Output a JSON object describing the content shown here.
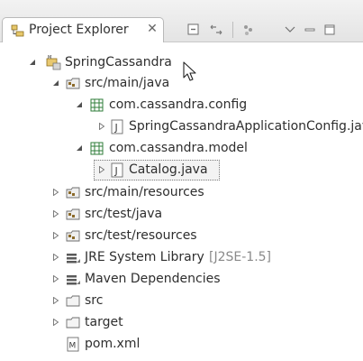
{
  "tab": {
    "label": "Project Explorer",
    "close": "✕"
  },
  "toolbar": {
    "icons": [
      "collapse-all-icon",
      "link-with-editor-icon",
      "focus-icon",
      "view-menu-icon",
      "minimize-icon",
      "maximize-icon"
    ]
  },
  "tree": {
    "items": [
      {
        "label": "SpringCassandra",
        "icon": "project-icon",
        "expanded": true
      },
      {
        "label": "src/main/java",
        "icon": "source-folder-icon",
        "expanded": true
      },
      {
        "label": "com.cassandra.config",
        "icon": "package-icon",
        "expanded": true
      },
      {
        "label": "SpringCassandraApplicationConfig.java",
        "icon": "java-file-icon",
        "expanded": false
      },
      {
        "label": "com.cassandra.model",
        "icon": "package-icon",
        "expanded": true
      },
      {
        "label": "Catalog.java",
        "icon": "java-file-icon",
        "expanded": false,
        "selected": true
      },
      {
        "label": "src/main/resources",
        "icon": "source-folder-icon",
        "expanded": false
      },
      {
        "label": "src/test/java",
        "icon": "source-folder-icon",
        "expanded": false
      },
      {
        "label": "src/test/resources",
        "icon": "source-folder-icon",
        "expanded": false
      },
      {
        "label": "JRE System Library",
        "decoration": "[J2SE-1.5]",
        "icon": "library-icon",
        "expanded": false
      },
      {
        "label": "Maven Dependencies",
        "icon": "library-icon",
        "expanded": false
      },
      {
        "label": "src",
        "icon": "folder-icon",
        "expanded": false
      },
      {
        "label": "target",
        "icon": "folder-icon",
        "expanded": false
      },
      {
        "label": "pom.xml",
        "icon": "maven-file-icon"
      }
    ]
  },
  "colors": {
    "selection_border": "#7a7a7a",
    "package_icon": "#2f7d3a",
    "folder_icon": "#d9b75a",
    "text_decoration": "#8a8a8a"
  }
}
